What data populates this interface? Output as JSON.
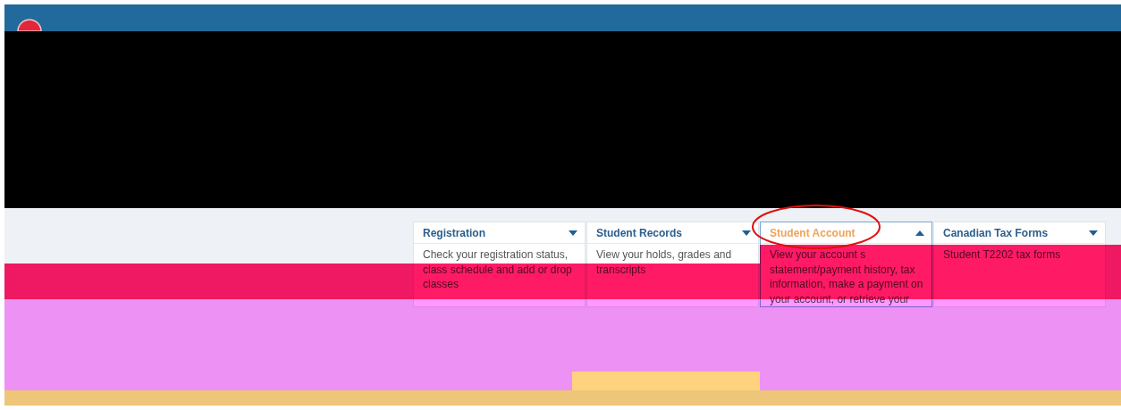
{
  "menu": [
    {
      "title": "Registration",
      "description": "Check your registration status, class schedule and add or drop classes",
      "expanded": false
    },
    {
      "title": "Student Records",
      "description": "View your holds, grades and transcripts",
      "expanded": false
    },
    {
      "title": "Student Account",
      "description": "View your account s statement/payment history, tax information, make a payment on your account, or retrieve your",
      "expanded": true
    },
    {
      "title": "Canadian Tax Forms",
      "description": "Student T2202 tax forms",
      "expanded": false
    }
  ]
}
